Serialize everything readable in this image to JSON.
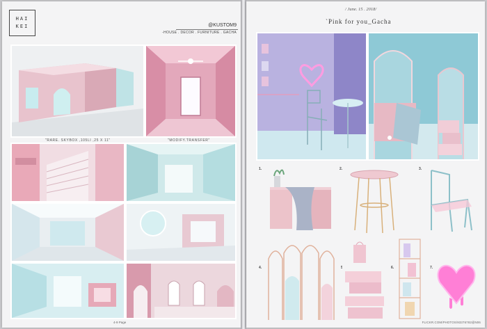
{
  "left_page": {
    "logo_lines": [
      "HAI",
      "KEI"
    ],
    "brand": "@KUSTOM9",
    "tagline": "-HOUSE . DECOR . FURNITURE . GACHA",
    "caption_rare": "\"RARE. SKYBOX ,105LI ,25 X 11\"",
    "caption_modify": "\"MODIFY.TRANSFER\"",
    "page_number": "4-9 Page"
  },
  "right_page": {
    "date": "/ June. 15 . 2018/",
    "title": "`Pink for you_Gacha",
    "items": [
      "1.",
      "2.",
      "3.",
      "4.",
      "5.",
      "6.",
      "7."
    ],
    "credit": "FLICKR.COM/PHOTOS/93376782@N06"
  },
  "colors": {
    "page": "#f4f4f5",
    "blush_pink": "#e8b9c4",
    "mint": "#bfe6e7",
    "lavender": "#b9b2e0",
    "neon_pink": "#ff7fd6"
  }
}
